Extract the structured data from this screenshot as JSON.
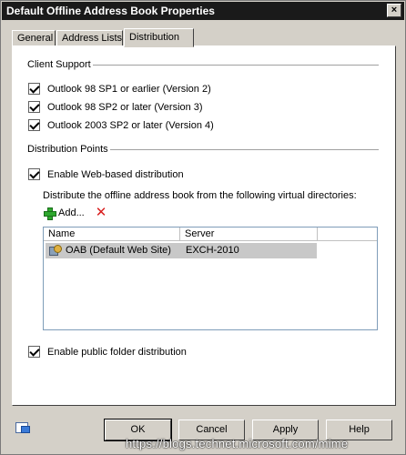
{
  "window": {
    "title": "Default Offline Address Book Properties",
    "close_glyph": "×"
  },
  "tabs": [
    {
      "label": "General",
      "active": false
    },
    {
      "label": "Address Lists",
      "active": false
    },
    {
      "label": "Distribution",
      "active": true
    }
  ],
  "client_support": {
    "label": "Client Support",
    "options": [
      {
        "label": "Outlook 98 SP1 or earlier (Version 2)",
        "checked": true
      },
      {
        "label": "Outlook 98 SP2 or later (Version 3)",
        "checked": true
      },
      {
        "label": "Outlook 2003 SP2 or later (Version 4)",
        "checked": true
      }
    ]
  },
  "distribution_points": {
    "label": "Distribution Points",
    "web_based": {
      "label": "Enable Web-based distribution",
      "checked": true
    },
    "description": "Distribute the offline address book from the following virtual directories:",
    "toolbar": {
      "add_label": "Add...",
      "add_icon": "plus-icon",
      "remove_icon": "x-icon"
    },
    "columns": [
      "Name",
      "Server"
    ],
    "rows": [
      {
        "name": "OAB (Default Web Site)",
        "server": "EXCH-2010",
        "icon": "web-site-icon"
      }
    ],
    "public_folder": {
      "label": "Enable public folder distribution",
      "checked": true
    }
  },
  "buttons": {
    "ok": "OK",
    "cancel": "Cancel",
    "apply": "Apply",
    "help": "Help"
  },
  "watermark": "https://blogs.technet.microsoft.com/mime",
  "colors": {
    "titlebar": "#1a1a1a",
    "dialog_bg": "#d4d0c8",
    "panel_bg": "#ffffff",
    "selected_row": "#c8c8c8",
    "add_icon": "#2ea82e",
    "remove_icon": "#d81e1e"
  }
}
